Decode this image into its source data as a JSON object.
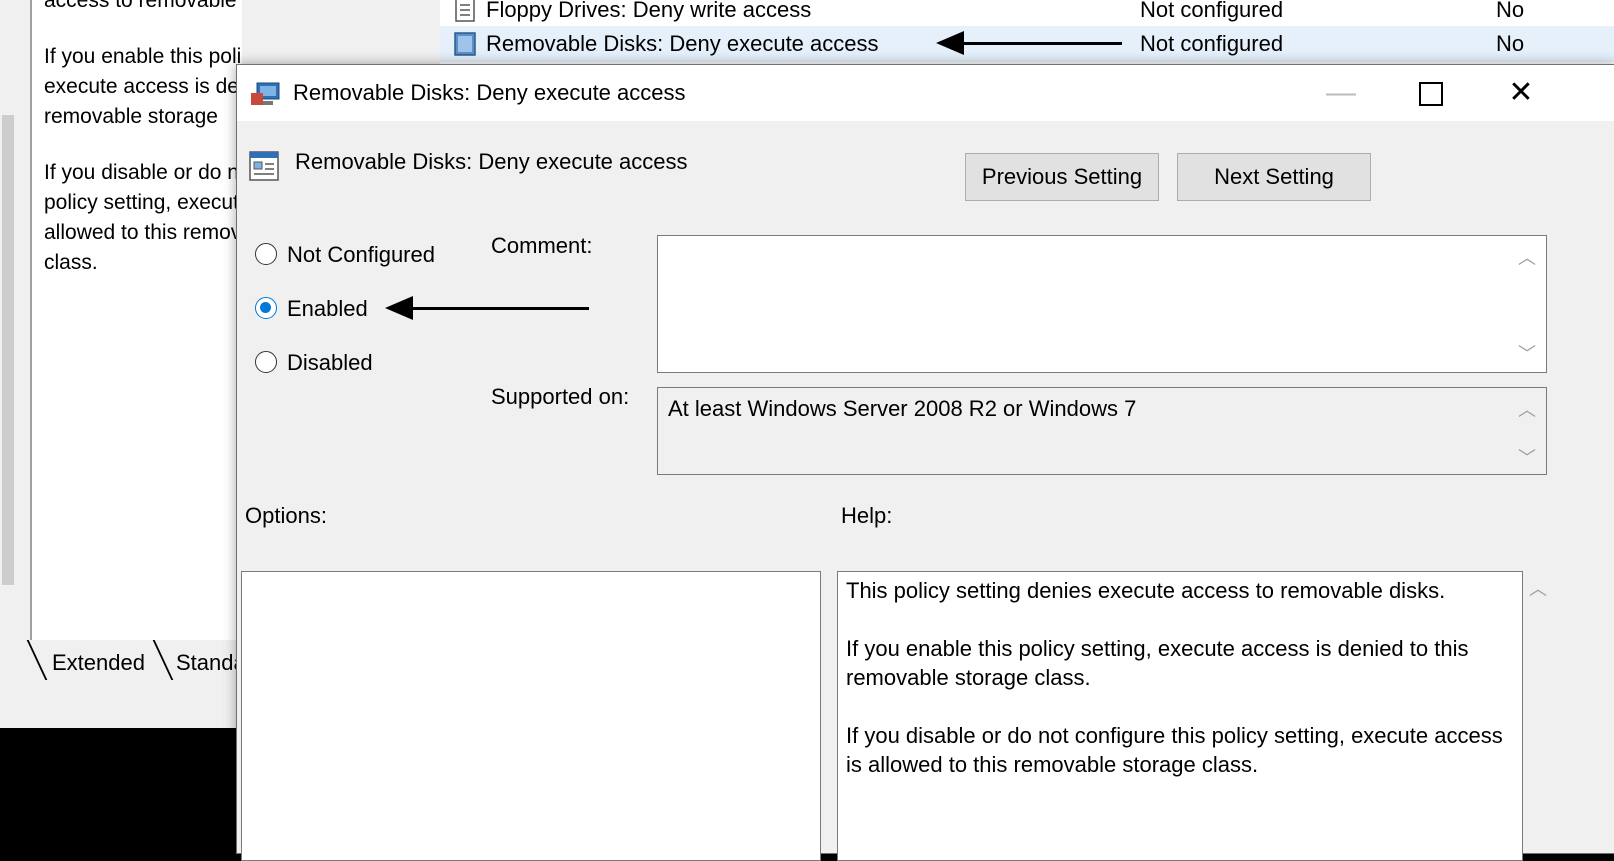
{
  "background_window": {
    "description_lines": [
      "access to removable disks.",
      "If you enable this policy setting, execute access is denied to this removable storage",
      "If you disable or do not configure this policy setting, execute access is allowed to this removable storage class."
    ],
    "tabs": [
      "Extended",
      "Standard"
    ],
    "policy_rows": [
      {
        "name": "Floppy Drives: Deny write access",
        "state": "Not configured",
        "comment": "No"
      },
      {
        "name": "Removable Disks: Deny execute access",
        "state": "Not configured",
        "comment": "No"
      }
    ]
  },
  "dialog": {
    "title": "Removable Disks: Deny execute access",
    "setting_title": "Removable Disks: Deny execute access",
    "prev_button": "Previous Setting",
    "next_button": "Next Setting",
    "radios": [
      {
        "label": "Not Configured",
        "checked": false
      },
      {
        "label": "Enabled",
        "checked": true
      },
      {
        "label": "Disabled",
        "checked": false
      }
    ],
    "comment_label": "Comment:",
    "comment_value": "",
    "supported_label": "Supported on:",
    "supported_value": "At least Windows Server 2008 R2 or Windows 7",
    "options_label": "Options:",
    "help_label": "Help:",
    "help_paragraphs": [
      "This policy setting denies execute access to removable disks.",
      "If you enable this policy setting, execute access is denied to this removable storage class.",
      "If you disable or do not configure this policy setting, execute access is allowed to this removable storage class."
    ]
  },
  "colors": {
    "accent": "#0078d7",
    "selected_row": "#e5f0fb",
    "dialog_bg": "#f0f0f0"
  }
}
